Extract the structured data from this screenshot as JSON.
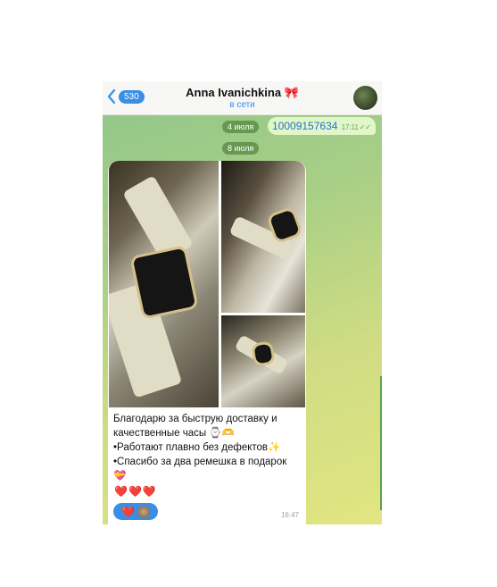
{
  "header": {
    "back_count": "530",
    "contact_name": "Anna Ivanichkina",
    "name_emoji": "🎀",
    "status": "в сети"
  },
  "chat": {
    "date_1": "4 июля",
    "outgoing_message": {
      "text": "10009157634",
      "time": "17:11",
      "read_mark": "✓✓"
    },
    "date_2": "8 июля",
    "incoming_message": {
      "line_1": "Благодарю за быструю доставку и качественные часы ⌚🫶",
      "line_2": "•Работают плавно без дефектов✨",
      "line_3": "•Спасибо за два ремешка в подарок 💝",
      "hearts": "❤️❤️❤️",
      "reaction": "❤️",
      "time": "16:47"
    }
  },
  "colors": {
    "accent": "#3a8ee6",
    "outgoing_bubble": "#e1f7c9",
    "heart": "#d61f2c"
  }
}
